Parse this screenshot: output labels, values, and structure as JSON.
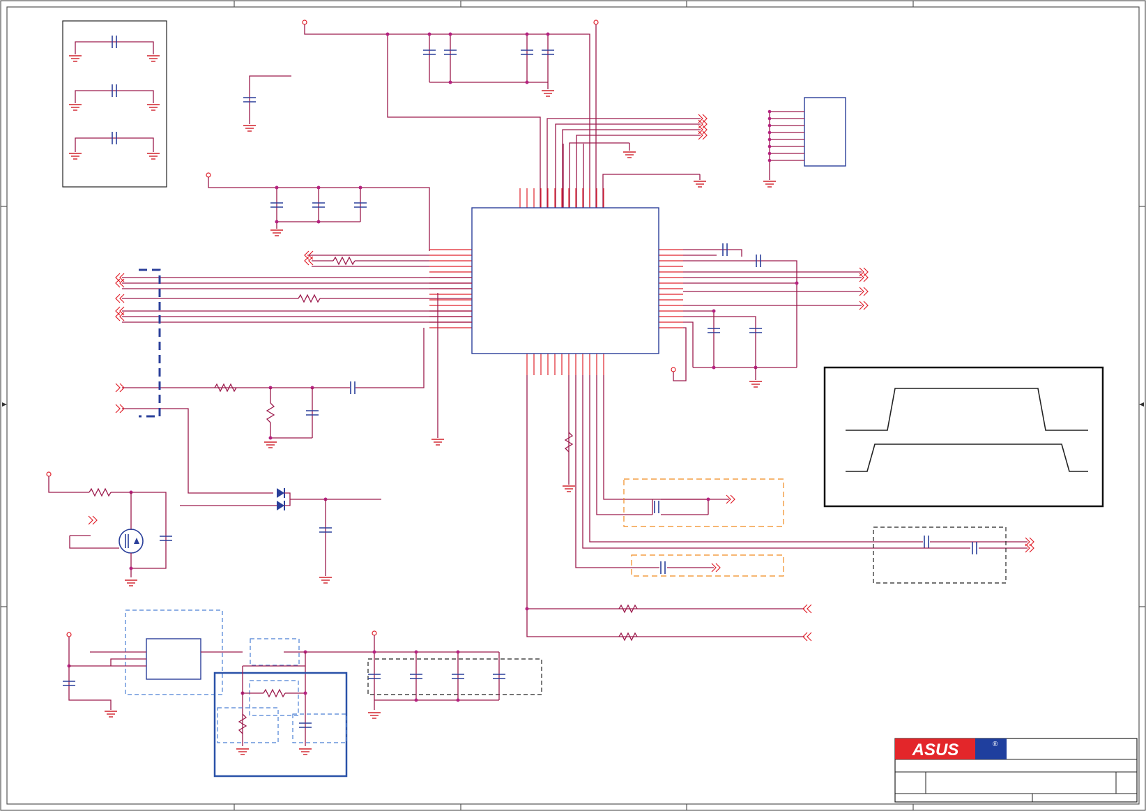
{
  "title_block": {
    "logo": "ASUS",
    "registered_mark": "®"
  },
  "colors": {
    "wire": "#9c1a4c",
    "pin": "#e0202a",
    "component": "#2a3f9a",
    "orange_box": "#f08a1e",
    "logo_red": "#e3262a",
    "logo_blue": "#1f3f9e"
  }
}
